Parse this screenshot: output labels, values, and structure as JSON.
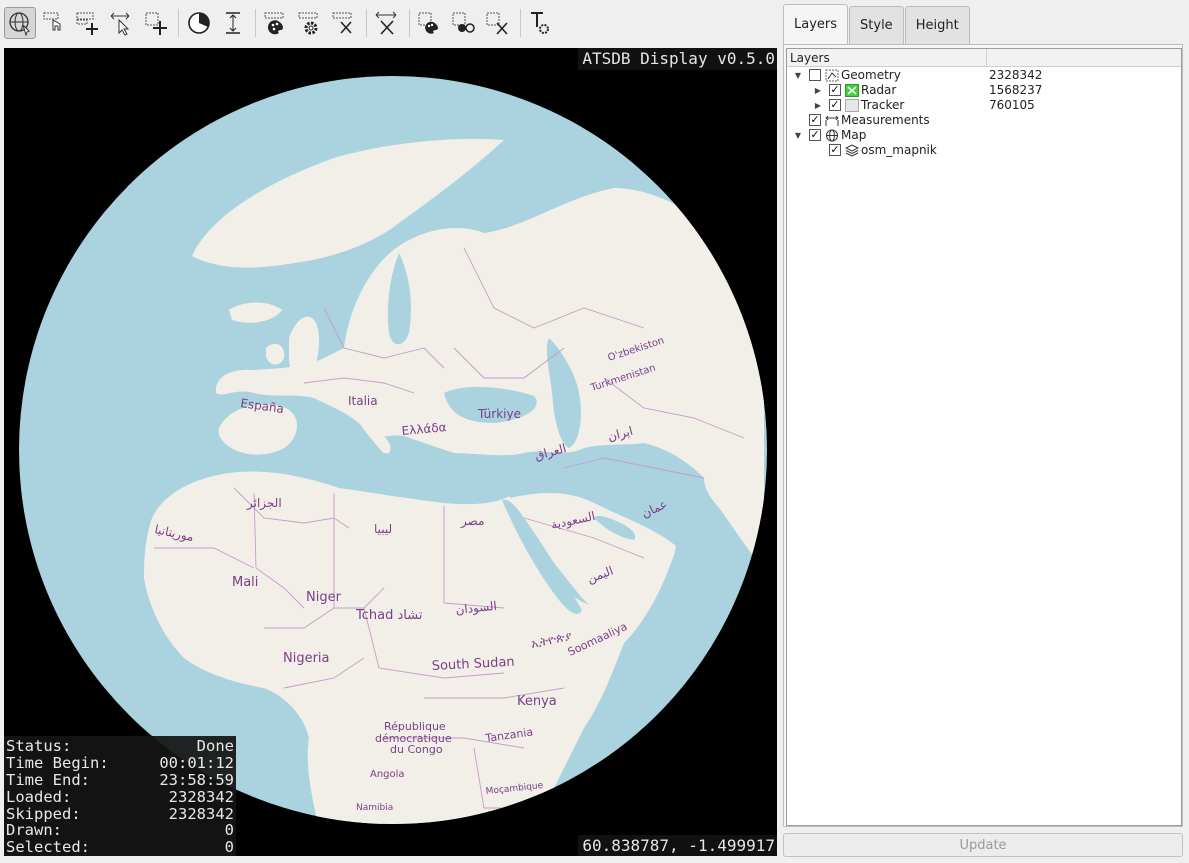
{
  "map": {
    "title": "ATSDB Display v0.5.0",
    "coordinates": "60.838787, -1.499917",
    "labels": [
      {
        "text": "España",
        "name": "label-espana"
      },
      {
        "text": "Italia",
        "name": "label-italia"
      },
      {
        "text": "Ελλάδα",
        "name": "label-ellada"
      },
      {
        "text": "Türkiye",
        "name": "label-turkiye"
      },
      {
        "text": "O'zbekiston",
        "name": "label-uzbekistan"
      },
      {
        "text": "Turkmenistan",
        "name": "label-turkmenistan"
      },
      {
        "text": "ایران",
        "name": "label-iran"
      },
      {
        "text": "العراق",
        "name": "label-iraq"
      },
      {
        "text": "الجزائر",
        "name": "label-algeria"
      },
      {
        "text": "موريتانيا",
        "name": "label-mauritania"
      },
      {
        "text": "ليبيا",
        "name": "label-libya"
      },
      {
        "text": "مصر",
        "name": "label-egypt"
      },
      {
        "text": "السعودية",
        "name": "label-saudi"
      },
      {
        "text": "عمان",
        "name": "label-oman"
      },
      {
        "text": "اليمن",
        "name": "label-yemen"
      },
      {
        "text": "Mali",
        "name": "label-mali"
      },
      {
        "text": "Niger",
        "name": "label-niger"
      },
      {
        "text": "Tchad تشاد",
        "name": "label-tchad"
      },
      {
        "text": "السودان",
        "name": "label-sudan"
      },
      {
        "text": "ኢትዮጵያ",
        "name": "label-ethiopia"
      },
      {
        "text": "Soomaaliya",
        "name": "label-somalia"
      },
      {
        "text": "Nigeria",
        "name": "label-nigeria"
      },
      {
        "text": "South Sudan",
        "name": "label-south-sudan"
      },
      {
        "text": "Kenya",
        "name": "label-kenya"
      },
      {
        "text": "République",
        "name": "label-rdc-1"
      },
      {
        "text": "démocratique",
        "name": "label-rdc-2"
      },
      {
        "text": "du Congo",
        "name": "label-rdc-3"
      },
      {
        "text": "Tanzania",
        "name": "label-tanzania"
      },
      {
        "text": "Angola",
        "name": "label-angola"
      },
      {
        "text": "Moçambique",
        "name": "label-mozambique"
      },
      {
        "text": "Namibia",
        "name": "label-namibia"
      }
    ]
  },
  "stats": [
    {
      "label": "Status:",
      "value": "Done"
    },
    {
      "label": "Time Begin:",
      "value": "00:01:12"
    },
    {
      "label": "Time End:",
      "value": "23:58:59"
    },
    {
      "label": "Loaded:",
      "value": "2328342"
    },
    {
      "label": "Skipped:",
      "value": "2328342"
    },
    {
      "label": "Drawn:",
      "value": "0"
    },
    {
      "label": "Selected:",
      "value": "0"
    }
  ],
  "toolbar": {
    "icons": [
      "navigate-globe-icon",
      "select-pointer-icon",
      "add-item-icon",
      "measure-cursor-icon",
      "add-selection-icon",
      "time-filter-icon",
      "height-filter-icon",
      "style-palette-icon",
      "settings-gear-icon",
      "delete-item-icon",
      "move-cross-icon",
      "select-palette-icon",
      "select-style-icon",
      "select-delete-icon",
      "text-style-icon"
    ]
  },
  "panel": {
    "tabs": [
      "Layers",
      "Style",
      "Height"
    ],
    "active_tab": "Layers",
    "tree_header": "Layers",
    "layers": [
      {
        "name": "Geometry",
        "count": "2328342",
        "checked": false,
        "expanded": true,
        "indent": 0,
        "icon": "geometry-icon"
      },
      {
        "name": "Radar",
        "count": "1568237",
        "checked": true,
        "expanded": false,
        "indent": 1,
        "icon": "radar-color-icon"
      },
      {
        "name": "Tracker",
        "count": "760105",
        "checked": true,
        "expanded": false,
        "indent": 1,
        "icon": "tracker-color-icon"
      },
      {
        "name": "Measurements",
        "count": "",
        "checked": true,
        "expanded": null,
        "indent": 0,
        "icon": "measurements-icon"
      },
      {
        "name": "Map",
        "count": "",
        "checked": true,
        "expanded": true,
        "indent": 0,
        "icon": "map-globe-icon"
      },
      {
        "name": "osm_mapnik",
        "count": "",
        "checked": true,
        "expanded": null,
        "indent": 1,
        "icon": "layers-stack-icon"
      }
    ],
    "update_label": "Update"
  },
  "colors": {
    "ocean": "#aad3df",
    "land": "#f2efe9",
    "border": "#c79bc8",
    "label": "#7a3f87",
    "radar": "#3cd23c"
  }
}
